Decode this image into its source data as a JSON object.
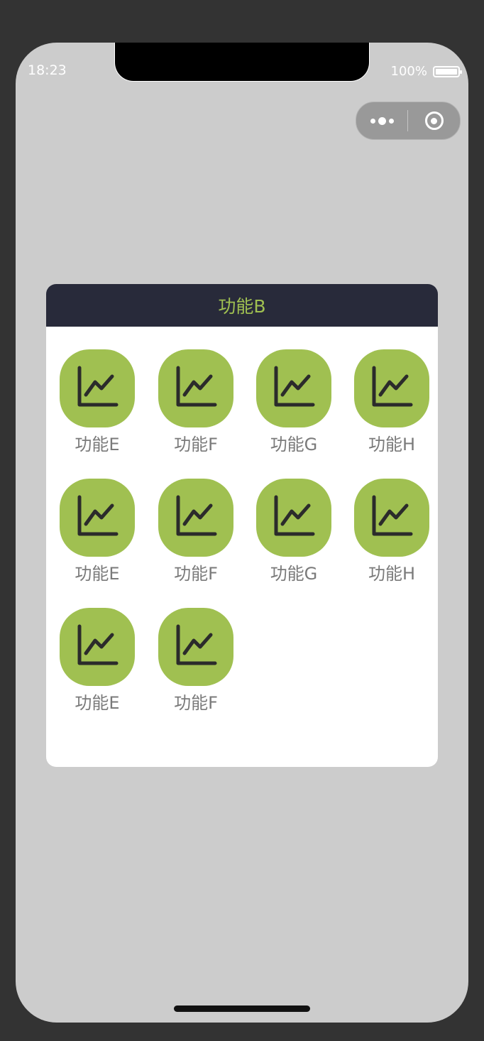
{
  "status_bar": {
    "time": "18:23",
    "battery": "100%"
  },
  "capsule": {
    "more_icon": "more-dots-icon",
    "close_icon": "target-circle-icon"
  },
  "panel": {
    "title": "功能B",
    "header_bg": "#282a3a",
    "title_color": "#a0c051",
    "tile_color": "#a0c051",
    "items": [
      {
        "label": "功能E",
        "icon": "line-chart-icon"
      },
      {
        "label": "功能F",
        "icon": "line-chart-icon"
      },
      {
        "label": "功能G",
        "icon": "line-chart-icon"
      },
      {
        "label": "功能H",
        "icon": "line-chart-icon"
      },
      {
        "label": "功能E",
        "icon": "line-chart-icon"
      },
      {
        "label": "功能F",
        "icon": "line-chart-icon"
      },
      {
        "label": "功能G",
        "icon": "line-chart-icon"
      },
      {
        "label": "功能H",
        "icon": "line-chart-icon"
      },
      {
        "label": "功能E",
        "icon": "line-chart-icon"
      },
      {
        "label": "功能F",
        "icon": "line-chart-icon"
      }
    ]
  }
}
